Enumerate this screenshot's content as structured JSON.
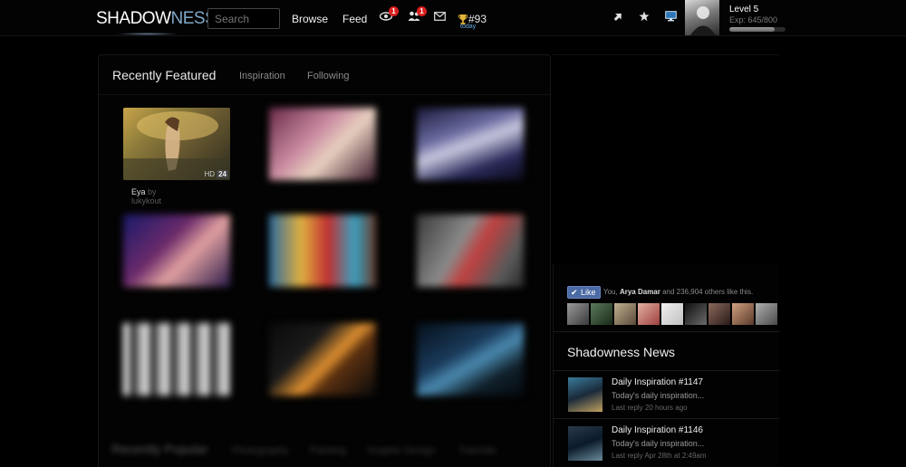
{
  "topbar": {
    "logo_main": "SHADOW",
    "logo_accent": "NESS",
    "search_placeholder": "Search",
    "nav": [
      "Browse",
      "Feed"
    ],
    "views_badge": "1",
    "friends_badge": "1",
    "trophy_rank": "#93",
    "trophy_label": "today",
    "level": "Level 5",
    "exp_text": "Exp: 645/800",
    "exp_progress": 0.806
  },
  "featured": {
    "title": "Recently Featured",
    "tabs": [
      "Inspiration",
      "Following"
    ],
    "items": [
      {
        "title": "Eya",
        "by": " by lukykout",
        "hd": "HD",
        "count": "24"
      }
    ]
  },
  "popular": {
    "title": "Recently Popular",
    "tabs": [
      "Photography",
      "Painting",
      "Graphic Design",
      "Tutorials"
    ]
  },
  "social": {
    "like_label": "Like",
    "like_prefix": "You, ",
    "like_name": "Arya Damar",
    "like_suffix": " and 236,904 others like this."
  },
  "news": {
    "title": "Shadowness News",
    "items": [
      {
        "name": "Daily Inspiration #1147",
        "desc": "Today's daily inspiration...",
        "meta": "Last reply 20 hours ago"
      },
      {
        "name": "Daily Inspiration #1146",
        "desc": "Today's daily inspiration...",
        "meta": "Last reply Apr 28th at 2:49am"
      }
    ]
  }
}
